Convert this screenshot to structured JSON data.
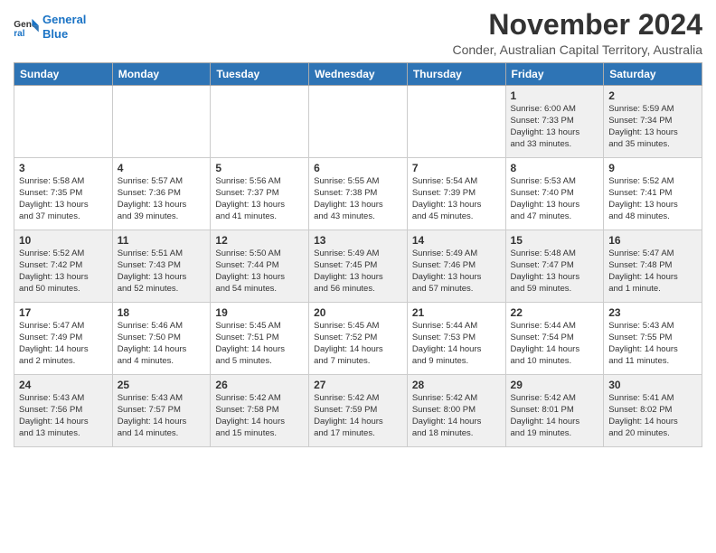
{
  "logo": {
    "line1": "General",
    "line2": "Blue"
  },
  "title": "November 2024",
  "subtitle": "Conder, Australian Capital Territory, Australia",
  "headers": [
    "Sunday",
    "Monday",
    "Tuesday",
    "Wednesday",
    "Thursday",
    "Friday",
    "Saturday"
  ],
  "weeks": [
    [
      {
        "day": "",
        "info": "",
        "shade": "empty"
      },
      {
        "day": "",
        "info": "",
        "shade": "empty"
      },
      {
        "day": "",
        "info": "",
        "shade": "empty"
      },
      {
        "day": "",
        "info": "",
        "shade": "empty"
      },
      {
        "day": "",
        "info": "",
        "shade": "empty"
      },
      {
        "day": "1",
        "info": "Sunrise: 6:00 AM\nSunset: 7:33 PM\nDaylight: 13 hours\nand 33 minutes.",
        "shade": "shaded"
      },
      {
        "day": "2",
        "info": "Sunrise: 5:59 AM\nSunset: 7:34 PM\nDaylight: 13 hours\nand 35 minutes.",
        "shade": "shaded"
      }
    ],
    [
      {
        "day": "3",
        "info": "Sunrise: 5:58 AM\nSunset: 7:35 PM\nDaylight: 13 hours\nand 37 minutes.",
        "shade": "white"
      },
      {
        "day": "4",
        "info": "Sunrise: 5:57 AM\nSunset: 7:36 PM\nDaylight: 13 hours\nand 39 minutes.",
        "shade": "white"
      },
      {
        "day": "5",
        "info": "Sunrise: 5:56 AM\nSunset: 7:37 PM\nDaylight: 13 hours\nand 41 minutes.",
        "shade": "white"
      },
      {
        "day": "6",
        "info": "Sunrise: 5:55 AM\nSunset: 7:38 PM\nDaylight: 13 hours\nand 43 minutes.",
        "shade": "white"
      },
      {
        "day": "7",
        "info": "Sunrise: 5:54 AM\nSunset: 7:39 PM\nDaylight: 13 hours\nand 45 minutes.",
        "shade": "white"
      },
      {
        "day": "8",
        "info": "Sunrise: 5:53 AM\nSunset: 7:40 PM\nDaylight: 13 hours\nand 47 minutes.",
        "shade": "white"
      },
      {
        "day": "9",
        "info": "Sunrise: 5:52 AM\nSunset: 7:41 PM\nDaylight: 13 hours\nand 48 minutes.",
        "shade": "white"
      }
    ],
    [
      {
        "day": "10",
        "info": "Sunrise: 5:52 AM\nSunset: 7:42 PM\nDaylight: 13 hours\nand 50 minutes.",
        "shade": "shaded"
      },
      {
        "day": "11",
        "info": "Sunrise: 5:51 AM\nSunset: 7:43 PM\nDaylight: 13 hours\nand 52 minutes.",
        "shade": "shaded"
      },
      {
        "day": "12",
        "info": "Sunrise: 5:50 AM\nSunset: 7:44 PM\nDaylight: 13 hours\nand 54 minutes.",
        "shade": "shaded"
      },
      {
        "day": "13",
        "info": "Sunrise: 5:49 AM\nSunset: 7:45 PM\nDaylight: 13 hours\nand 56 minutes.",
        "shade": "shaded"
      },
      {
        "day": "14",
        "info": "Sunrise: 5:49 AM\nSunset: 7:46 PM\nDaylight: 13 hours\nand 57 minutes.",
        "shade": "shaded"
      },
      {
        "day": "15",
        "info": "Sunrise: 5:48 AM\nSunset: 7:47 PM\nDaylight: 13 hours\nand 59 minutes.",
        "shade": "shaded"
      },
      {
        "day": "16",
        "info": "Sunrise: 5:47 AM\nSunset: 7:48 PM\nDaylight: 14 hours\nand 1 minute.",
        "shade": "shaded"
      }
    ],
    [
      {
        "day": "17",
        "info": "Sunrise: 5:47 AM\nSunset: 7:49 PM\nDaylight: 14 hours\nand 2 minutes.",
        "shade": "white"
      },
      {
        "day": "18",
        "info": "Sunrise: 5:46 AM\nSunset: 7:50 PM\nDaylight: 14 hours\nand 4 minutes.",
        "shade": "white"
      },
      {
        "day": "19",
        "info": "Sunrise: 5:45 AM\nSunset: 7:51 PM\nDaylight: 14 hours\nand 5 minutes.",
        "shade": "white"
      },
      {
        "day": "20",
        "info": "Sunrise: 5:45 AM\nSunset: 7:52 PM\nDaylight: 14 hours\nand 7 minutes.",
        "shade": "white"
      },
      {
        "day": "21",
        "info": "Sunrise: 5:44 AM\nSunset: 7:53 PM\nDaylight: 14 hours\nand 9 minutes.",
        "shade": "white"
      },
      {
        "day": "22",
        "info": "Sunrise: 5:44 AM\nSunset: 7:54 PM\nDaylight: 14 hours\nand 10 minutes.",
        "shade": "white"
      },
      {
        "day": "23",
        "info": "Sunrise: 5:43 AM\nSunset: 7:55 PM\nDaylight: 14 hours\nand 11 minutes.",
        "shade": "white"
      }
    ],
    [
      {
        "day": "24",
        "info": "Sunrise: 5:43 AM\nSunset: 7:56 PM\nDaylight: 14 hours\nand 13 minutes.",
        "shade": "shaded"
      },
      {
        "day": "25",
        "info": "Sunrise: 5:43 AM\nSunset: 7:57 PM\nDaylight: 14 hours\nand 14 minutes.",
        "shade": "shaded"
      },
      {
        "day": "26",
        "info": "Sunrise: 5:42 AM\nSunset: 7:58 PM\nDaylight: 14 hours\nand 15 minutes.",
        "shade": "shaded"
      },
      {
        "day": "27",
        "info": "Sunrise: 5:42 AM\nSunset: 7:59 PM\nDaylight: 14 hours\nand 17 minutes.",
        "shade": "shaded"
      },
      {
        "day": "28",
        "info": "Sunrise: 5:42 AM\nSunset: 8:00 PM\nDaylight: 14 hours\nand 18 minutes.",
        "shade": "shaded"
      },
      {
        "day": "29",
        "info": "Sunrise: 5:42 AM\nSunset: 8:01 PM\nDaylight: 14 hours\nand 19 minutes.",
        "shade": "shaded"
      },
      {
        "day": "30",
        "info": "Sunrise: 5:41 AM\nSunset: 8:02 PM\nDaylight: 14 hours\nand 20 minutes.",
        "shade": "shaded"
      }
    ]
  ]
}
